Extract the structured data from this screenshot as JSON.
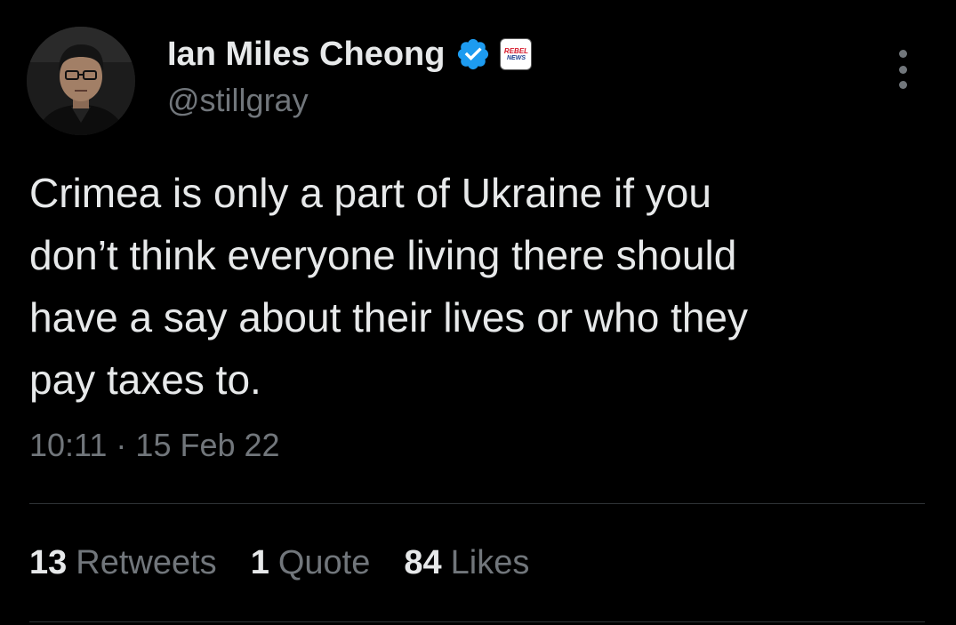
{
  "author": {
    "display_name": "Ian Miles Cheong",
    "handle": "@stillgray",
    "affiliate_badge": {
      "line1": "REBEL",
      "line2": "NEWS"
    }
  },
  "tweet": {
    "text": "Crimea is only a part of Ukraine if you\ndon’t think everyone living there should\nhave a say about their lives or who they\npay taxes to.",
    "time": "10:11",
    "separator": " · ",
    "date": "15 Feb 22"
  },
  "stats": {
    "retweets_count": "13",
    "retweets_label": "Retweets",
    "quotes_count": "1",
    "quotes_label": "Quote",
    "likes_count": "84",
    "likes_label": "Likes"
  },
  "icons": {
    "verified": "verified-checkmark-icon",
    "more": "more-options-icon"
  },
  "colors": {
    "background": "#000000",
    "primary_text": "#e7e9ea",
    "secondary_text": "#71767b",
    "verified_blue": "#1d9bf0",
    "divider": "#2f3336"
  }
}
